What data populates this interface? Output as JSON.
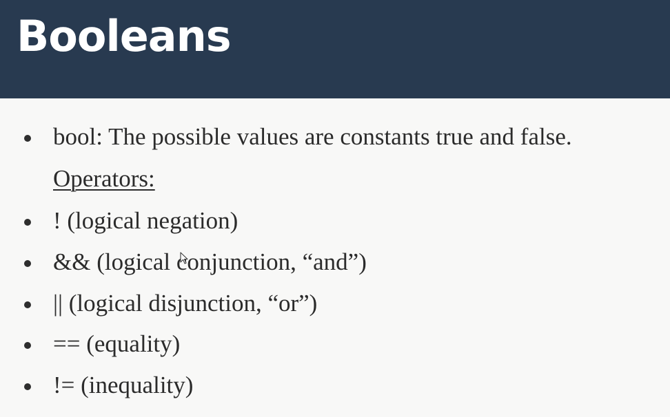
{
  "slide": {
    "title": "Booleans",
    "items": [
      {
        "bullet": true,
        "text": "bool: The possible values are constants true and false."
      },
      {
        "bullet": false,
        "text": "Operators:"
      },
      {
        "bullet": true,
        "text": "! (logical negation)"
      },
      {
        "bullet": true,
        "text": "&& (logical conjunction, “and”)"
      },
      {
        "bullet": true,
        "text": "|| (logical disjunction, “or”)"
      },
      {
        "bullet": true,
        "text": "== (equality)"
      },
      {
        "bullet": true,
        "text": "!= (inequality)"
      }
    ]
  },
  "colors": {
    "title_bar": "#283a50",
    "title_text": "#ffffff",
    "body_text": "#2b2b2b",
    "background": "#f8f8f7"
  },
  "icons": {
    "cursor": "mouse-pointer-icon",
    "bullet": "bullet-dot-icon"
  }
}
